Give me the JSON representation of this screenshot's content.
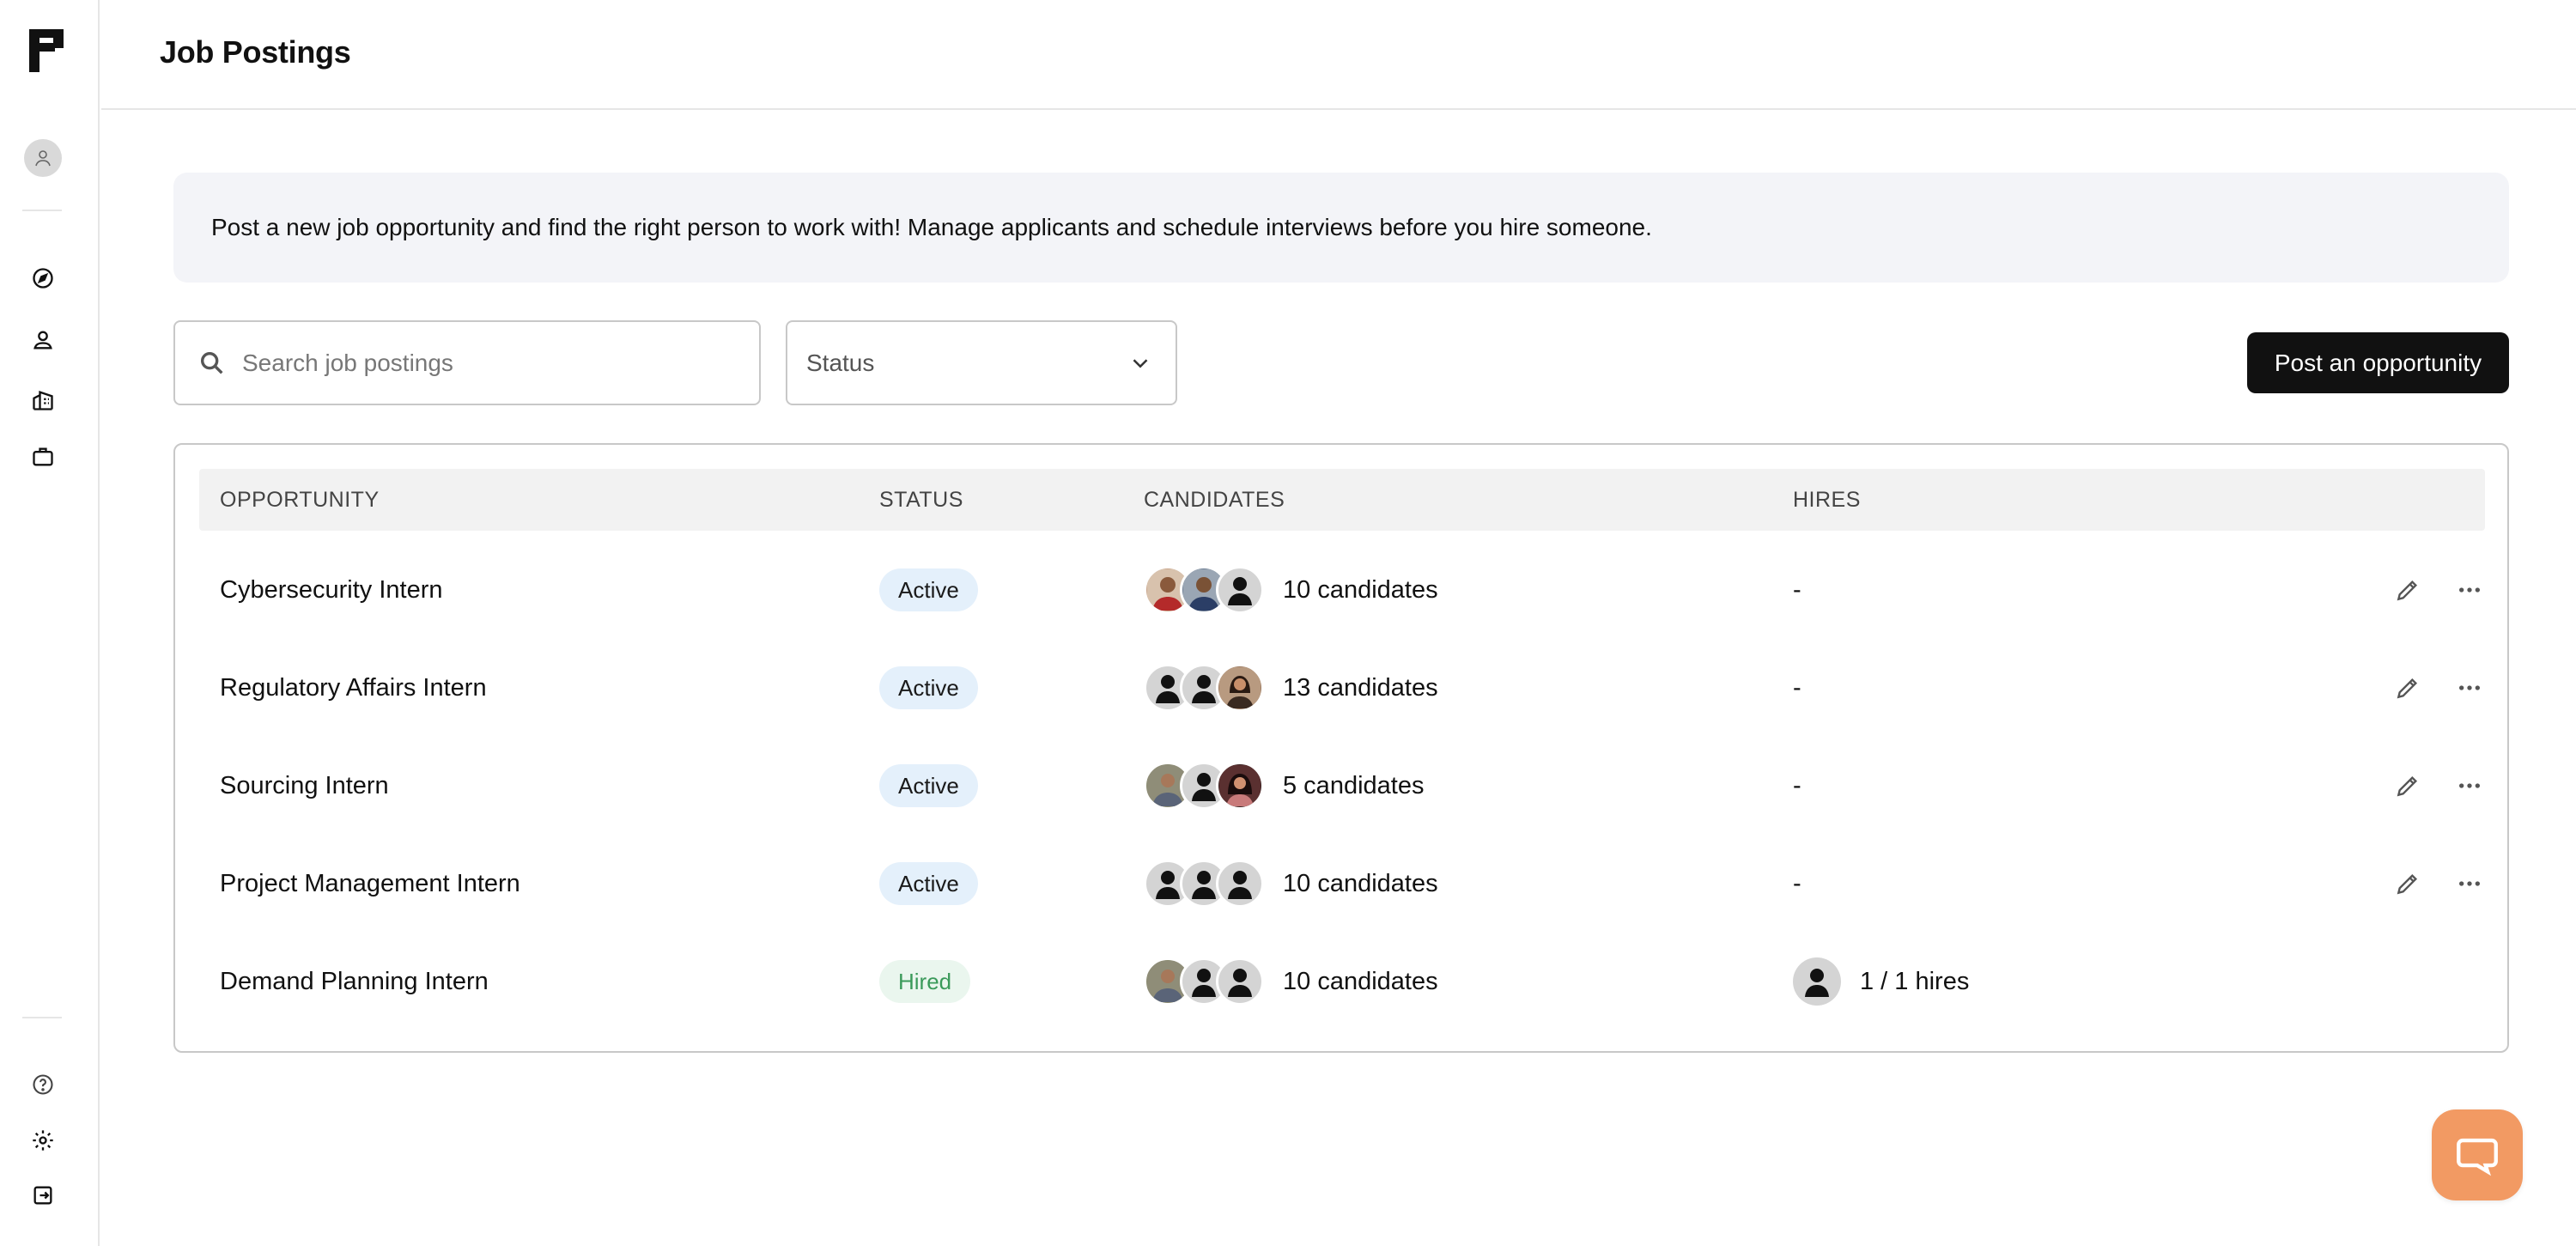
{
  "app": {
    "page_title": "Job Postings",
    "accent_color": "#111111",
    "chat_color": "#f29a63"
  },
  "sidebar": {
    "logo_icon": "brand-logo-icon",
    "avatar_icon": "user-avatar-icon",
    "nav": [
      {
        "icon": "compass-icon",
        "name": "explore"
      },
      {
        "icon": "person-icon",
        "name": "people"
      },
      {
        "icon": "building-icon",
        "name": "company"
      },
      {
        "icon": "briefcase-icon",
        "name": "jobs"
      }
    ],
    "bottom": [
      {
        "icon": "help-icon",
        "name": "help"
      },
      {
        "icon": "gear-icon",
        "name": "settings"
      },
      {
        "icon": "logout-icon",
        "name": "logout"
      }
    ]
  },
  "banner": {
    "text": "Post a new job opportunity and find the right person to work with! Manage applicants and schedule interviews before you hire someone."
  },
  "search": {
    "placeholder": "Search job postings",
    "value": ""
  },
  "status_filter": {
    "selected": "Status"
  },
  "post_button": {
    "label": "Post an opportunity"
  },
  "table": {
    "columns": [
      "OPPORTUNITY",
      "STATUS",
      "CANDIDATES",
      "HIRES"
    ],
    "rows": [
      {
        "opportunity": "Cybersecurity Intern",
        "status": "Active",
        "status_type": "active",
        "candidates": "10 candidates",
        "hires": "-",
        "avatars": [
          "photo-red",
          "photo-blue",
          "placeholder"
        ],
        "actions": true
      },
      {
        "opportunity": "Regulatory Affairs Intern",
        "status": "Active",
        "status_type": "active",
        "candidates": "13 candidates",
        "hires": "-",
        "avatars": [
          "placeholder",
          "placeholder",
          "photo-brown"
        ],
        "actions": true
      },
      {
        "opportunity": "Sourcing Intern",
        "status": "Active",
        "status_type": "active",
        "candidates": "5 candidates",
        "hires": "-",
        "avatars": [
          "photo-olive",
          "placeholder",
          "photo-dark"
        ],
        "actions": true
      },
      {
        "opportunity": "Project Management Intern",
        "status": "Active",
        "status_type": "active",
        "candidates": "10 candidates",
        "hires": "-",
        "avatars": [
          "placeholder",
          "placeholder",
          "placeholder"
        ],
        "actions": true
      },
      {
        "opportunity": "Demand Planning Intern",
        "status": "Hired",
        "status_type": "hired",
        "candidates": "10 candidates",
        "hires": "1 / 1 hires",
        "avatars": [
          "photo-olive",
          "placeholder",
          "placeholder"
        ],
        "actions": false
      }
    ]
  }
}
